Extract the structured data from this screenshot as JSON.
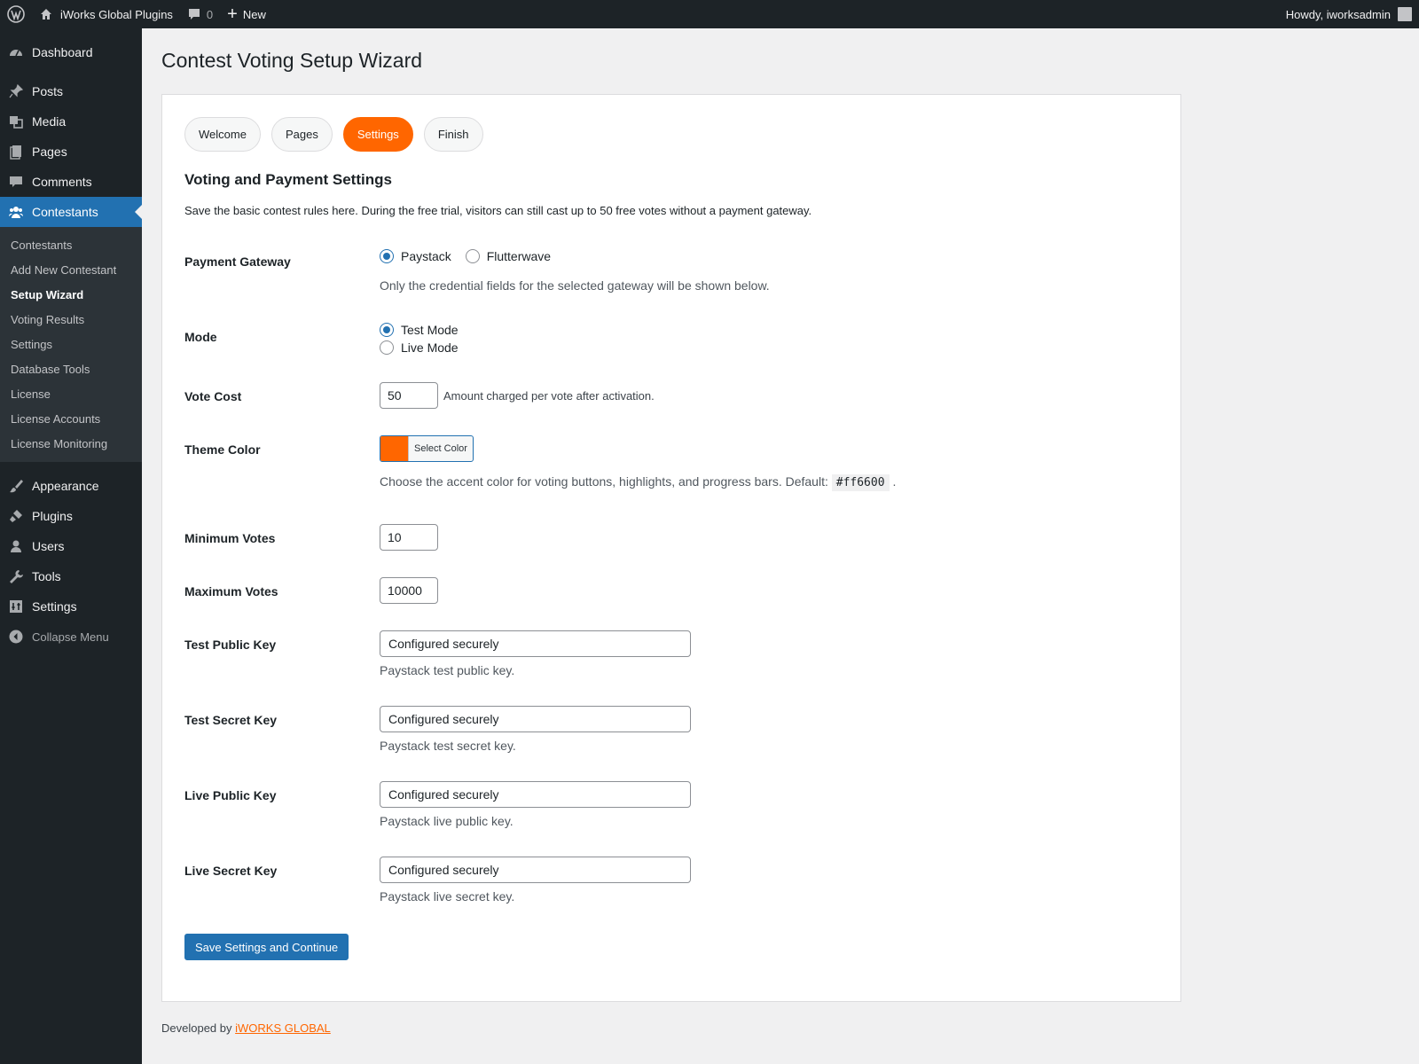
{
  "adminbar": {
    "site_name": "iWorks Global Plugins",
    "comments_count": "0",
    "new_label": "New",
    "howdy": "Howdy, iworksadmin"
  },
  "sidebar": {
    "top_items": [
      {
        "label": "Dashboard",
        "icon": "dashboard-icon"
      },
      {
        "label": "Posts",
        "icon": "pin-icon"
      },
      {
        "label": "Media",
        "icon": "media-icon"
      },
      {
        "label": "Pages",
        "icon": "pages-icon"
      },
      {
        "label": "Comments",
        "icon": "comment-icon"
      },
      {
        "label": "Contestants",
        "icon": "groups-icon"
      }
    ],
    "submenu": [
      "Contestants",
      "Add New Contestant",
      "Setup Wizard",
      "Voting Results",
      "Settings",
      "Database Tools",
      "License",
      "License Accounts",
      "License Monitoring"
    ],
    "bottom_items": [
      {
        "label": "Appearance",
        "icon": "brush-icon"
      },
      {
        "label": "Plugins",
        "icon": "plugin-icon"
      },
      {
        "label": "Users",
        "icon": "users-icon"
      },
      {
        "label": "Tools",
        "icon": "wrench-icon"
      },
      {
        "label": "Settings",
        "icon": "settings-icon"
      }
    ],
    "collapse": "Collapse Menu"
  },
  "page": {
    "title": "Contest Voting Setup Wizard",
    "steps": [
      "Welcome",
      "Pages",
      "Settings",
      "Finish"
    ],
    "active_step": "Settings",
    "section_title": "Voting and Payment Settings",
    "section_desc": "Save the basic contest rules here. During the free trial, visitors can still cast up to 50 free votes without a payment gateway."
  },
  "form": {
    "gateway": {
      "label": "Payment Gateway",
      "options": [
        "Paystack",
        "Flutterwave"
      ],
      "selected": "Paystack",
      "desc": "Only the credential fields for the selected gateway will be shown below."
    },
    "mode": {
      "label": "Mode",
      "options": [
        "Test Mode",
        "Live Mode"
      ],
      "selected": "Test Mode"
    },
    "vote_cost": {
      "label": "Vote Cost",
      "value": "50",
      "desc": "Amount charged per vote after activation."
    },
    "theme_color": {
      "label": "Theme Color",
      "value": "#ff6600",
      "button": "Select Color",
      "desc": "Choose the accent color for voting buttons, highlights, and progress bars. Default:",
      "default_hex": "#ff6600",
      "trailing": "."
    },
    "min_votes": {
      "label": "Minimum Votes",
      "value": "10"
    },
    "max_votes": {
      "label": "Maximum Votes",
      "value": "10000"
    },
    "test_public": {
      "label": "Test Public Key",
      "value": "Configured securely",
      "desc": "Paystack test public key."
    },
    "test_secret": {
      "label": "Test Secret Key",
      "value": "Configured securely",
      "desc": "Paystack test secret key."
    },
    "live_public": {
      "label": "Live Public Key",
      "value": "Configured securely",
      "desc": "Paystack live public key."
    },
    "live_secret": {
      "label": "Live Secret Key",
      "value": "Configured securely",
      "desc": "Paystack live secret key."
    },
    "submit": "Save Settings and Continue"
  },
  "footer": {
    "prefix": "Developed by",
    "link": "iWORKS GLOBAL"
  },
  "colors": {
    "accent": "#ff6600",
    "primary": "#2271b1",
    "sidebar_bg": "#1d2327"
  }
}
